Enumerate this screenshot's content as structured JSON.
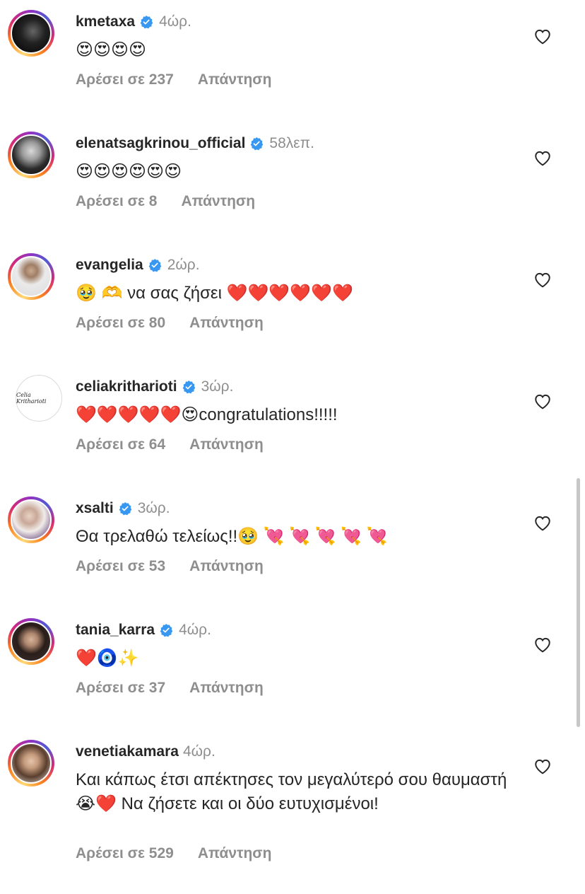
{
  "labels": {
    "reply": "Απάντηση"
  },
  "comments": [
    {
      "username": "kmetaxa",
      "time": "4ώρ.",
      "text": "😍😍😍😍",
      "likes": "Αρέσει σε 237"
    },
    {
      "username": "elenatsagkrinou_official",
      "time": "58λεπ.",
      "text": "😍😍😍😍😍😍",
      "likes": "Αρέσει σε 8"
    },
    {
      "username": "evangelia",
      "time": "2ώρ.",
      "text": "🥹 🫶 να σας ζήσει ❤️❤️❤️❤️❤️❤️",
      "likes": "Αρέσει σε 80"
    },
    {
      "username": "celiakritharioti",
      "time": "3ώρ.",
      "text": "❤️❤️❤️❤️❤️😍congratulations!!!!!",
      "likes": "Αρέσει σε 64",
      "avatar_text": "Celia Kritharioti"
    },
    {
      "username": "xsalti",
      "time": "3ώρ.",
      "text": "Θα τρελαθώ τελείως!!🥹 💘 💘 💘 💘 💘",
      "likes": "Αρέσει σε 53"
    },
    {
      "username": "tania_karra",
      "time": "4ώρ.",
      "text": "❤️🧿✨",
      "likes": "Αρέσει σε 37"
    },
    {
      "username": "venetiakamara",
      "time": "4ώρ.",
      "text": "Και κάπως έτσι απέκτησες τον μεγαλύτερό σου θαυμαστή 😭❤️ Να ζήσετε και οι δύο ευτυχισμένοι!",
      "likes": "Αρέσει σε 529"
    }
  ],
  "colors": {
    "verified": "#3897f0",
    "secondary_text": "#8e8e8e"
  }
}
